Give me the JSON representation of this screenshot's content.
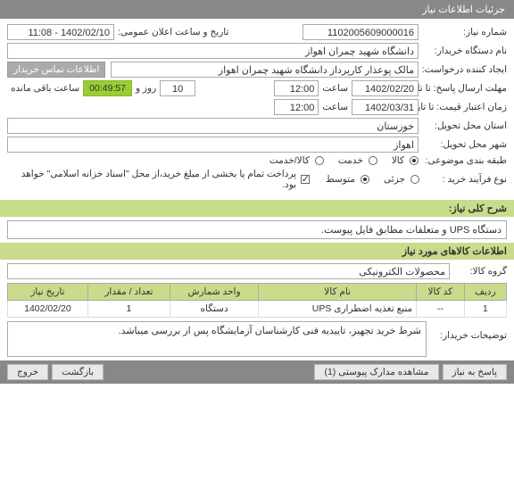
{
  "header": {
    "title": "جزئیات اطلاعات نیاز"
  },
  "fields": {
    "need_no_label": "شماره نیاز:",
    "need_no": "1102005609000016",
    "public_ann_label": "تاریخ و ساعت اعلان عمومی:",
    "public_ann": "1402/02/10 - 11:08",
    "buyer_org_label": "نام دستگاه خریدار:",
    "buyer_org": "دانشگاه شهید چمران اهواز",
    "creator_label": "ایجاد کننده درخواست:",
    "creator": "مالک پوعذار کارپرداز دانشگاه شهید چمران اهواز",
    "contact_btn": "اطلاعات تماس خریدار",
    "deadline_label": "مهلت ارسال پاسخ: تا تاریخ:",
    "deadline_date": "1402/02/20",
    "hour_word": "ساعت",
    "deadline_time": "12:00",
    "day_word": "روز و",
    "days_left": "10",
    "countdown": "00:49:57",
    "remain_word": "ساعت باقی مانده",
    "valid_label": "زمان اعتبار قیمت: تا تاریخ:",
    "valid_date": "1402/03/31",
    "valid_time": "12:00",
    "province_label": "استان محل تحویل:",
    "province": "خوزستان",
    "city_label": "شهر محل تحویل:",
    "city": "اهواز",
    "category_label": "طبقه بندی موضوعی:",
    "cat_goods": "کالا",
    "cat_service": "خدمت",
    "cat_goods_service": "کالا/خدمت",
    "buy_type_label": "نوع فرآیند خرید :",
    "buy_partial": "جزئی",
    "buy_mid": "متوسط",
    "buy_note": "پرداخت تمام یا بخشی از مبلغ خرید،از محل \"اسناد خزانه اسلامی\" خواهد بود."
  },
  "sections": {
    "desc_title": "شرح کلی نیاز:",
    "desc_value": "دستگاه UPS و متعلقات مطابق فایل پیوست.",
    "items_title": "اطلاعات کالاهای مورد نیاز",
    "group_label": "گروه کالا:",
    "group_value": "محصولات الکترونیکی",
    "buyer_notes_label": "توضیحات خریدار:",
    "buyer_notes_value": "شرط خرید تجهیز، تاییدیه فنی کارشناسان آزمایشگاه پس از بررسی میباشد."
  },
  "table": {
    "headers": {
      "row": "ردیف",
      "code": "کد کالا",
      "name": "نام کالا",
      "unit": "واحد شمارش",
      "qty": "تعداد / مقدار",
      "date": "تاریخ نیاز"
    },
    "rows": [
      {
        "row": "1",
        "code": "--",
        "name": "منبع تغذیه اضطراری UPS",
        "unit": "دستگاه",
        "qty": "1",
        "date": "1402/02/20"
      }
    ]
  },
  "footer": {
    "reply": "پاسخ به نیاز",
    "attachments": "مشاهده مدارک پیوستی (1)",
    "back": "بازگشت",
    "exit": "خروج"
  }
}
